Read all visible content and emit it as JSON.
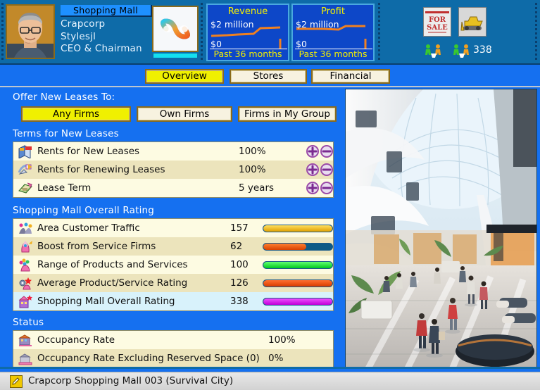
{
  "header": {
    "title_chip": "Shopping Mall",
    "company": "Crapcorp",
    "person": "Stylesjl",
    "role": "CEO & Chairman",
    "portrait_icon": "executive-portrait",
    "logo_icon": "infinity-logo",
    "for_sale_icon": "for-sale-sign-icon",
    "bulldozer_icon": "bulldozer-icon",
    "people_icon": "pedestrians-icon",
    "people_count": "338",
    "stats": [
      {
        "name": "revenue",
        "title": "Revenue",
        "top_value": "$2 million",
        "bottom_value": "$0",
        "footer": "Past 36 months"
      },
      {
        "name": "profit",
        "title": "Profit",
        "top_value": "$2 million",
        "bottom_value": "$0",
        "footer": "Past 36 months"
      }
    ]
  },
  "tabs": [
    {
      "label": "Overview",
      "active": true
    },
    {
      "label": "Stores",
      "active": false
    },
    {
      "label": "Financial",
      "active": false
    }
  ],
  "offer_leases": {
    "label": "Offer New Leases To:",
    "options": [
      {
        "label": "Any Firms",
        "active": true
      },
      {
        "label": "Own Firms",
        "active": false
      },
      {
        "label": "Firms in My Group",
        "active": false
      }
    ]
  },
  "terms": {
    "heading": "Terms for New Leases",
    "rows": [
      {
        "icon": "rent-new-leases-icon",
        "label": "Rents for New Leases",
        "value": "100%",
        "plus": "+",
        "minus": "−"
      },
      {
        "icon": "rent-renewing-leases-icon",
        "label": "Rents for Renewing Leases",
        "value": "100%",
        "plus": "+",
        "minus": "−"
      },
      {
        "icon": "lease-term-icon",
        "label": "Lease Term",
        "value": "5 years",
        "plus": "+",
        "minus": "−"
      }
    ]
  },
  "rating": {
    "heading": "Shopping Mall Overall Rating",
    "rows": [
      {
        "icon": "area-customer-traffic-icon",
        "label": "Area Customer Traffic",
        "value": "157",
        "bar_pct": 100,
        "bar_color": "#f0b800"
      },
      {
        "icon": "boost-service-firms-icon",
        "label": "Boost from Service Firms",
        "value": "62",
        "bar_pct": 62,
        "bar_color": "#ef5a18"
      },
      {
        "icon": "range-products-services-icon",
        "label": "Range of Products and Services",
        "value": "100",
        "bar_pct": 100,
        "bar_color": "#16e030"
      },
      {
        "icon": "average-product-rating-icon",
        "label": "Average Product/Service Rating",
        "value": "126",
        "bar_pct": 100,
        "bar_color": "#ef5a18"
      },
      {
        "icon": "mall-overall-rating-icon",
        "label": "Shopping Mall Overall Rating",
        "value": "338",
        "bar_pct": 100,
        "bar_color": "#e020e0"
      }
    ]
  },
  "status_section": {
    "heading": "Status",
    "rows": [
      {
        "icon": "occupancy-rate-icon",
        "label": "Occupancy Rate",
        "value": "100%"
      },
      {
        "icon": "occupancy-excl-reserved-icon",
        "label": "Occupancy Rate Excluding Reserved Space (0)",
        "value": "0%"
      }
    ]
  },
  "preview": {
    "alt": "shopping-mall-interior-photo"
  },
  "statusbar": {
    "icon": "edit-pencil-icon",
    "text": "Crapcorp Shopping Mall 003 (Survival City)"
  },
  "colors": {
    "header_bg": "#0e6ba8",
    "panel_bg": "#1570f0",
    "accent_yellow": "#f0f000",
    "list_bg": "#fdfbe2",
    "list_alt": "#ece4bc",
    "list_hilite": "#d8f2fb"
  }
}
